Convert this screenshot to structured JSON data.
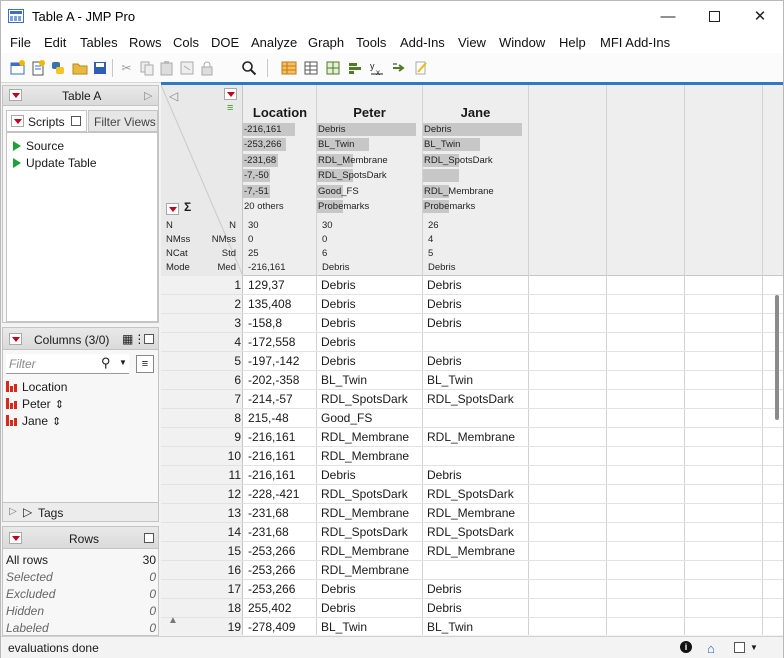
{
  "window": {
    "title": "Table A - JMP Pro"
  },
  "menu": [
    "File",
    "Edit",
    "Tables",
    "Rows",
    "Cols",
    "DOE",
    "Analyze",
    "Graph",
    "Tools",
    "Add-Ins",
    "View",
    "Window",
    "Help",
    "MFI Add-Ins"
  ],
  "table_panel": {
    "title": "Table A",
    "tab_scripts": "Scripts",
    "tab_filter": "Filter Views",
    "scripts": [
      "Source",
      "Update Table"
    ]
  },
  "columns_panel": {
    "title": "Columns (3/0)",
    "filter_placeholder": "Filter",
    "columns": [
      "Location",
      "Peter",
      "Jane"
    ],
    "tags_label": "Tags"
  },
  "rows_panel": {
    "title": "Rows",
    "items": [
      {
        "label": "All rows",
        "value": "30"
      },
      {
        "label": "Selected",
        "value": "0"
      },
      {
        "label": "Excluded",
        "value": "0"
      },
      {
        "label": "Hidden",
        "value": "0"
      },
      {
        "label": "Labeled",
        "value": "0"
      }
    ]
  },
  "grid": {
    "columns": [
      "Location",
      "Peter",
      "Jane"
    ],
    "header_stats": {
      "location": [
        {
          "text": "-216,161",
          "fill": 0.72
        },
        {
          "text": "-253,266",
          "fill": 0.6
        },
        {
          "text": "-231,68",
          "fill": 0.48
        },
        {
          "text": "-7,-50",
          "fill": 0.38
        },
        {
          "text": "-7,-51",
          "fill": 0.38
        },
        {
          "text": "20 others",
          "fill": 0
        }
      ],
      "peter": [
        {
          "text": "Debris",
          "fill": 0.95
        },
        {
          "text": "BL_Twin",
          "fill": 0.5
        },
        {
          "text": "RDL_Membrane",
          "fill": 0.35
        },
        {
          "text": "RDL_SpotsDark",
          "fill": 0.35
        },
        {
          "text": "Good_FS",
          "fill": 0.25
        },
        {
          "text": "Probemarks",
          "fill": 0.25
        }
      ],
      "jane": [
        {
          "text": "Debris",
          "fill": 0.95
        },
        {
          "text": "BL_Twin",
          "fill": 0.55
        },
        {
          "text": "RDL_SpotsDark",
          "fill": 0.35
        },
        {
          "text": "",
          "fill": 0.35
        },
        {
          "text": "RDL_Membrane",
          "fill": 0.25
        },
        {
          "text": "Probemarks",
          "fill": 0.25
        }
      ]
    },
    "summary_left": [
      "N",
      "NMss",
      "NCat",
      "Mode"
    ],
    "summary_right": [
      "N",
      "NMss",
      "Std",
      "Med"
    ],
    "summary_values": {
      "location": [
        "30",
        "0",
        "25",
        "-216,161"
      ],
      "peter": [
        "30",
        "0",
        "6",
        "Debris"
      ],
      "jane": [
        "26",
        "4",
        "5",
        "Debris"
      ]
    },
    "rows": [
      [
        "1",
        "129,37",
        "Debris",
        "Debris"
      ],
      [
        "2",
        "135,408",
        "Debris",
        "Debris"
      ],
      [
        "3",
        "-158,8",
        "Debris",
        "Debris"
      ],
      [
        "4",
        "-172,558",
        "Debris",
        ""
      ],
      [
        "5",
        "-197,-142",
        "Debris",
        "Debris"
      ],
      [
        "6",
        "-202,-358",
        "BL_Twin",
        "BL_Twin"
      ],
      [
        "7",
        "-214,-57",
        "RDL_SpotsDark",
        "RDL_SpotsDark"
      ],
      [
        "8",
        "215,-48",
        "Good_FS",
        ""
      ],
      [
        "9",
        "-216,161",
        "RDL_Membrane",
        "RDL_Membrane"
      ],
      [
        "10",
        "-216,161",
        "RDL_Membrane",
        ""
      ],
      [
        "11",
        "-216,161",
        "Debris",
        "Debris"
      ],
      [
        "12",
        "-228,-421",
        "RDL_SpotsDark",
        "RDL_SpotsDark"
      ],
      [
        "13",
        "-231,68",
        "RDL_Membrane",
        "RDL_Membrane"
      ],
      [
        "14",
        "-231,68",
        "RDL_SpotsDark",
        "RDL_SpotsDark"
      ],
      [
        "15",
        "-253,266",
        "RDL_Membrane",
        "RDL_Membrane"
      ],
      [
        "16",
        "-253,266",
        "RDL_Membrane",
        ""
      ],
      [
        "17",
        "-253,266",
        "Debris",
        "Debris"
      ],
      [
        "18",
        "255,402",
        "Debris",
        "Debris"
      ],
      [
        "19",
        "-278,409",
        "BL_Twin",
        "BL_Twin"
      ]
    ]
  },
  "status": {
    "text": "evaluations done"
  }
}
